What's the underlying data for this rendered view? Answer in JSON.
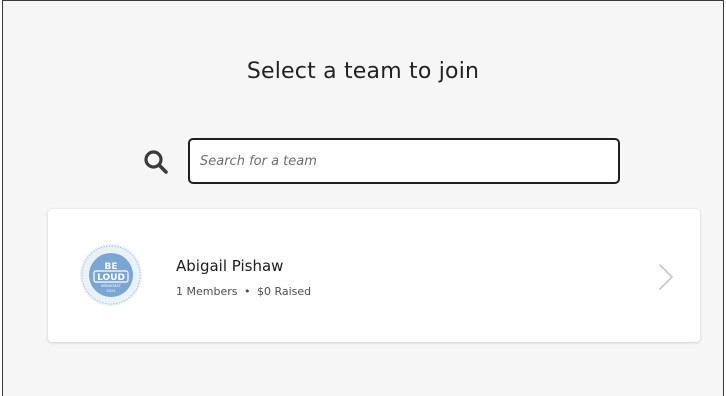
{
  "page": {
    "title": "Select a team to join"
  },
  "search": {
    "placeholder": "Search for a team",
    "value": "",
    "icon": "search-icon"
  },
  "teams": [
    {
      "name": "Abigail Pishaw",
      "members_text": "1 Members",
      "separator": "•",
      "raised_text": "$0 Raised",
      "avatar": {
        "top_text": "BE",
        "main_text": "LOUD",
        "sub_text": "BREAKFAST",
        "year": "2022",
        "color": "#7aa6d4"
      },
      "chevron_icon": "chevron-right-icon"
    }
  ],
  "colors": {
    "background": "#f6f6f6",
    "card": "#ffffff",
    "input_border": "#1f1f1f",
    "chevron": "#c8c8c8"
  }
}
